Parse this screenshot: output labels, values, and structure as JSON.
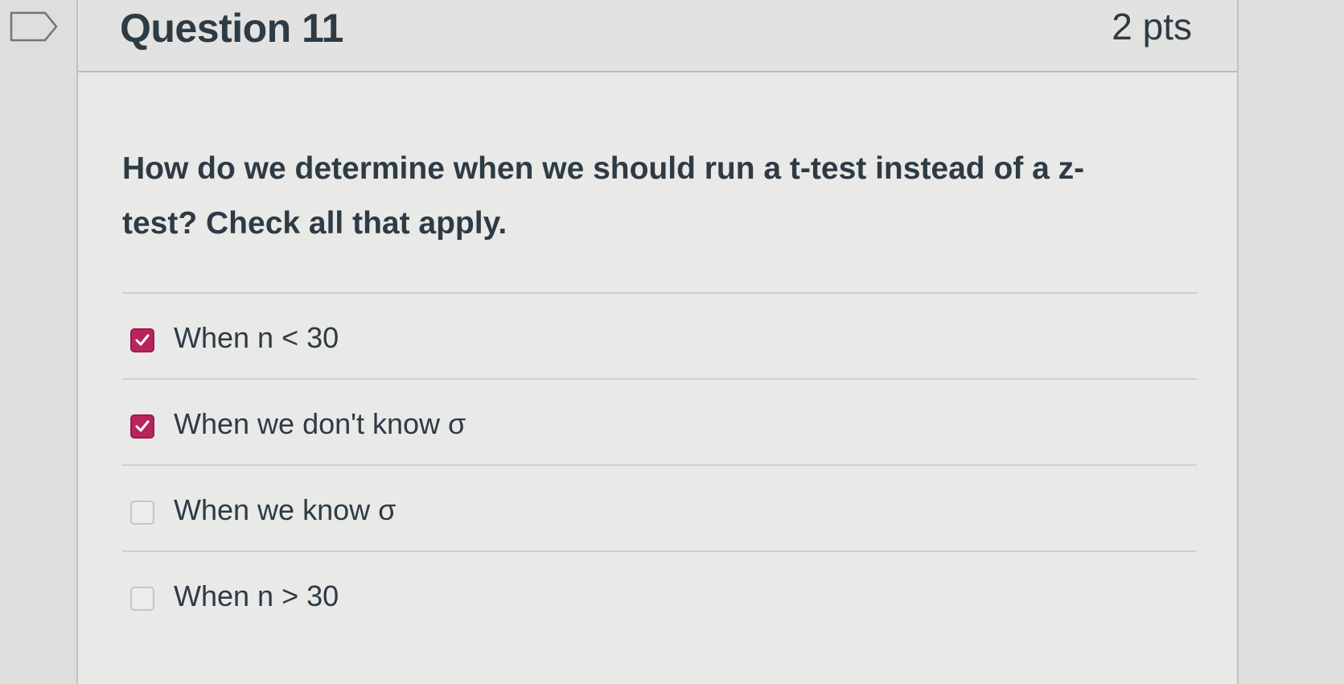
{
  "question": {
    "title": "Question 11",
    "points": "2 pts",
    "text": "How do we determine when we should run a t-test instead of a z-test? Check all that apply."
  },
  "answers": [
    {
      "label": "When n < 30",
      "checked": true
    },
    {
      "label": "When we don't know σ",
      "checked": true
    },
    {
      "label": "When we know σ",
      "checked": false
    },
    {
      "label": "When n > 30",
      "checked": false
    }
  ],
  "colors": {
    "checkbox_checked": "#b8245c",
    "text": "#2d3b45"
  },
  "icons": {
    "flag": "bookmark-flag-icon",
    "check": "checkmark-icon"
  }
}
